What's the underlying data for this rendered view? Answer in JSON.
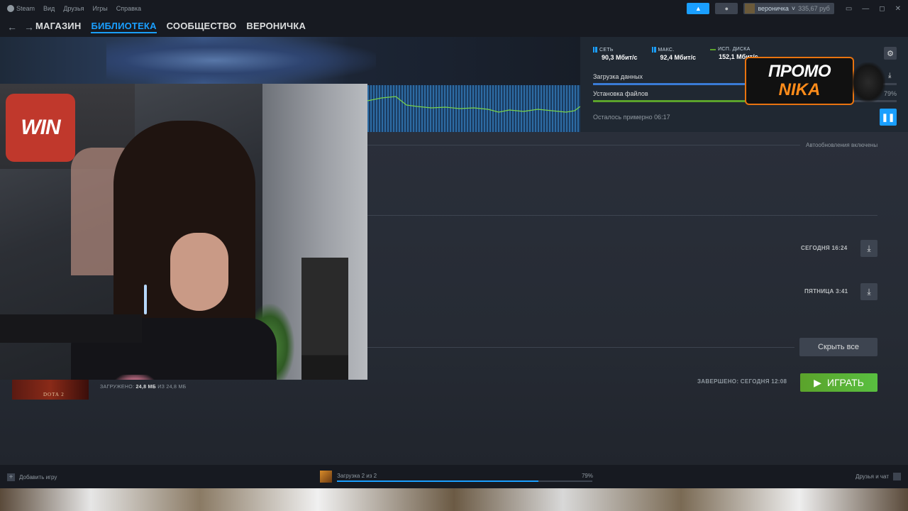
{
  "menu": {
    "steam": "Steam",
    "items": [
      "Вид",
      "Друзья",
      "Игры",
      "Справка"
    ]
  },
  "account": {
    "name": "вероничка",
    "balance": "335,67 руб"
  },
  "nav": {
    "tabs": [
      "МАГАЗИН",
      "БИБЛИОТЕКА",
      "СООБЩЕСТВО",
      "ВЕРОНИЧКА"
    ],
    "active_index": 1
  },
  "stats": {
    "network_label": "СЕТЬ",
    "network_value": "90,3 Мбит/с",
    "max_label": "МАКС.",
    "max_value": "92,4 Мбит/с",
    "disk_label": "ИСП. ДИСКА",
    "disk_value": "152,1 Мбит/с"
  },
  "download": {
    "data_label": "Загрузка данных",
    "data_progress": 0.5,
    "files_label": "Установка файлов",
    "files_percent": "79%",
    "files_progress": 0.79,
    "remaining": "Осталось примерно 06:17"
  },
  "promo": {
    "line1": "ПРОМО",
    "line2": "NIKA"
  },
  "queue": {
    "auto_updates": "Автообновления включены",
    "scheduled": [
      {
        "time": "СЕГОДНЯ 16:24"
      },
      {
        "time": "ПЯТНИЦА 3:41"
      }
    ],
    "hide_all": "Скрыть все"
  },
  "completed": {
    "game_logo": "DOTA 2",
    "downloaded_label": "ЗАГРУЖЕНО:",
    "downloaded_amount": "24,8 МБ",
    "downloaded_of": "ИЗ 24,8 МБ",
    "finished": "ЗАВЕРШЕНО: СЕГОДНЯ 12:08",
    "play": "ИГРАТЬ"
  },
  "webcam": {
    "sign": "WIN"
  },
  "bottom": {
    "add_game": "Добавить игру",
    "download_status": "Загрузка 2 из 2",
    "download_percent": "79%",
    "download_progress": 0.79,
    "friends_chat": "Друзья и чат"
  },
  "colors": {
    "accent": "#1a9fff",
    "play": "#5ba32b",
    "promo_border": "#e8730f"
  }
}
